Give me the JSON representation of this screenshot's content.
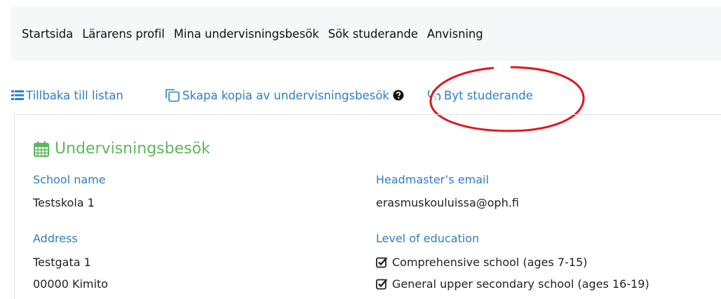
{
  "nav": {
    "items": [
      {
        "label": "Startsida"
      },
      {
        "label": "Lärarens profil"
      },
      {
        "label": "Mina undervisningsbesök"
      },
      {
        "label": "Sök studerande"
      },
      {
        "label": "Anvisning"
      }
    ]
  },
  "actions": {
    "back_label": "Tillbaka till listan",
    "copy_label": "Skapa kopia av undervisningsbesök",
    "switch_label": "Byt studerande"
  },
  "panel": {
    "title": "Undervisningsbesök",
    "school_name_label": "School name",
    "school_name_value": "Testskola 1",
    "address_label": "Address",
    "address_line1": "Testgata 1",
    "address_line2": "00000 Kimito",
    "email_label": "Headmaster’s email",
    "email_value": "erasmuskouluissa@oph.fi",
    "level_label": "Level of education",
    "levels": [
      "Comprehensive school (ages 7-15)",
      "General upper secondary school (ages 16-19)"
    ]
  },
  "icons": {
    "list": "list-icon",
    "copy": "copy-icon",
    "question": "question-circle-icon",
    "switch": "switch-user-icon",
    "calendar": "calendar-icon",
    "check": "checkbox-checked-icon"
  },
  "colors": {
    "link": "#2f7ec3",
    "title": "#5cb85c",
    "highlight": "#e3151a",
    "nav_bg": "#f6f7f8"
  }
}
